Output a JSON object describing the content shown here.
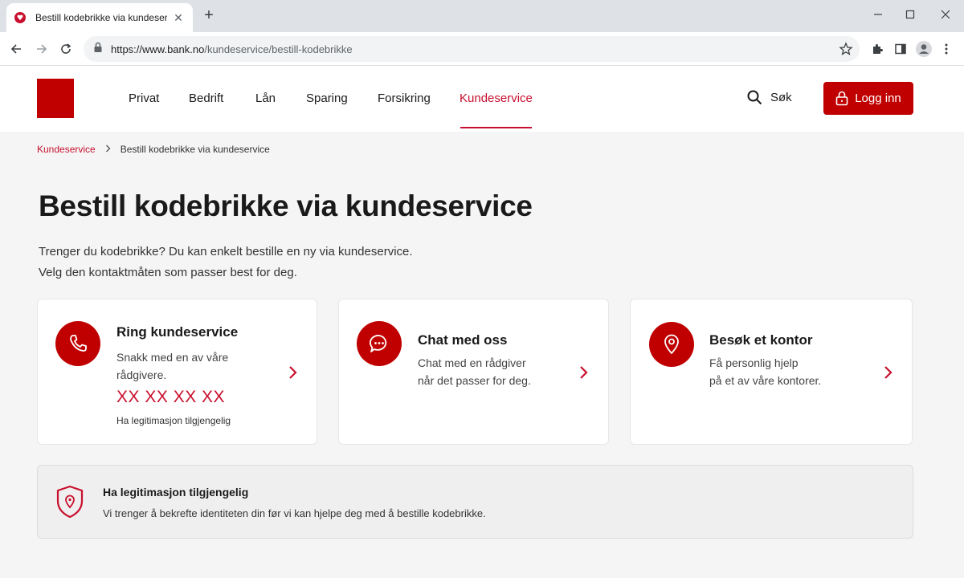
{
  "browser": {
    "tab_title": "Bestill kodebrikke via kundeservice",
    "url_host": "https://www.bank.no",
    "url_path": "/kundeservice/bestill-kodebrikke"
  },
  "header": {
    "nav": [
      "Privat",
      "Bedrift",
      "Lån",
      "Sparing",
      "Forsikring",
      "Kundeservice"
    ],
    "active_nav": "Kundeservice",
    "search_label": "Søk",
    "login_label": "Logg inn"
  },
  "breadcrumb": {
    "parent": "Kundeservice",
    "current": "Bestill kodebrikke via kundeservice"
  },
  "page": {
    "title": "Bestill kodebrikke via kundeservice",
    "intro_line1": "Trenger du kodebrikke? Du kan enkelt bestille en ny via kundeservice.",
    "intro_line2": "Velg den kontaktmåten som passer best for deg."
  },
  "cards": [
    {
      "title": "Ring kundeservice",
      "desc_line1": "Snakk med en av våre",
      "desc_line2": "rådgivere.",
      "phone": "XX XX XX XX",
      "note": "Ha legitimasjon tilgjengelig",
      "icon": "phone-icon"
    },
    {
      "title": "Chat med oss",
      "desc_line1": "Chat med en rådgiver",
      "desc_line2": "når det passer for deg.",
      "icon": "chat-icon"
    },
    {
      "title": "Besøk et kontor",
      "desc_line1": "Få personlig hjelp",
      "desc_line2": "på et av våre kontorer.",
      "icon": "location-pin-icon"
    }
  ],
  "info": {
    "title": "Ha legitimasjon tilgjengelig",
    "text": "Vi trenger å bekrefte identiteten din før vi kan hjelpe deg med å bestille kodebrikke.",
    "icon": "shield-icon"
  },
  "colors": {
    "brand_red": "#c00000",
    "link_red": "#c8102e"
  }
}
